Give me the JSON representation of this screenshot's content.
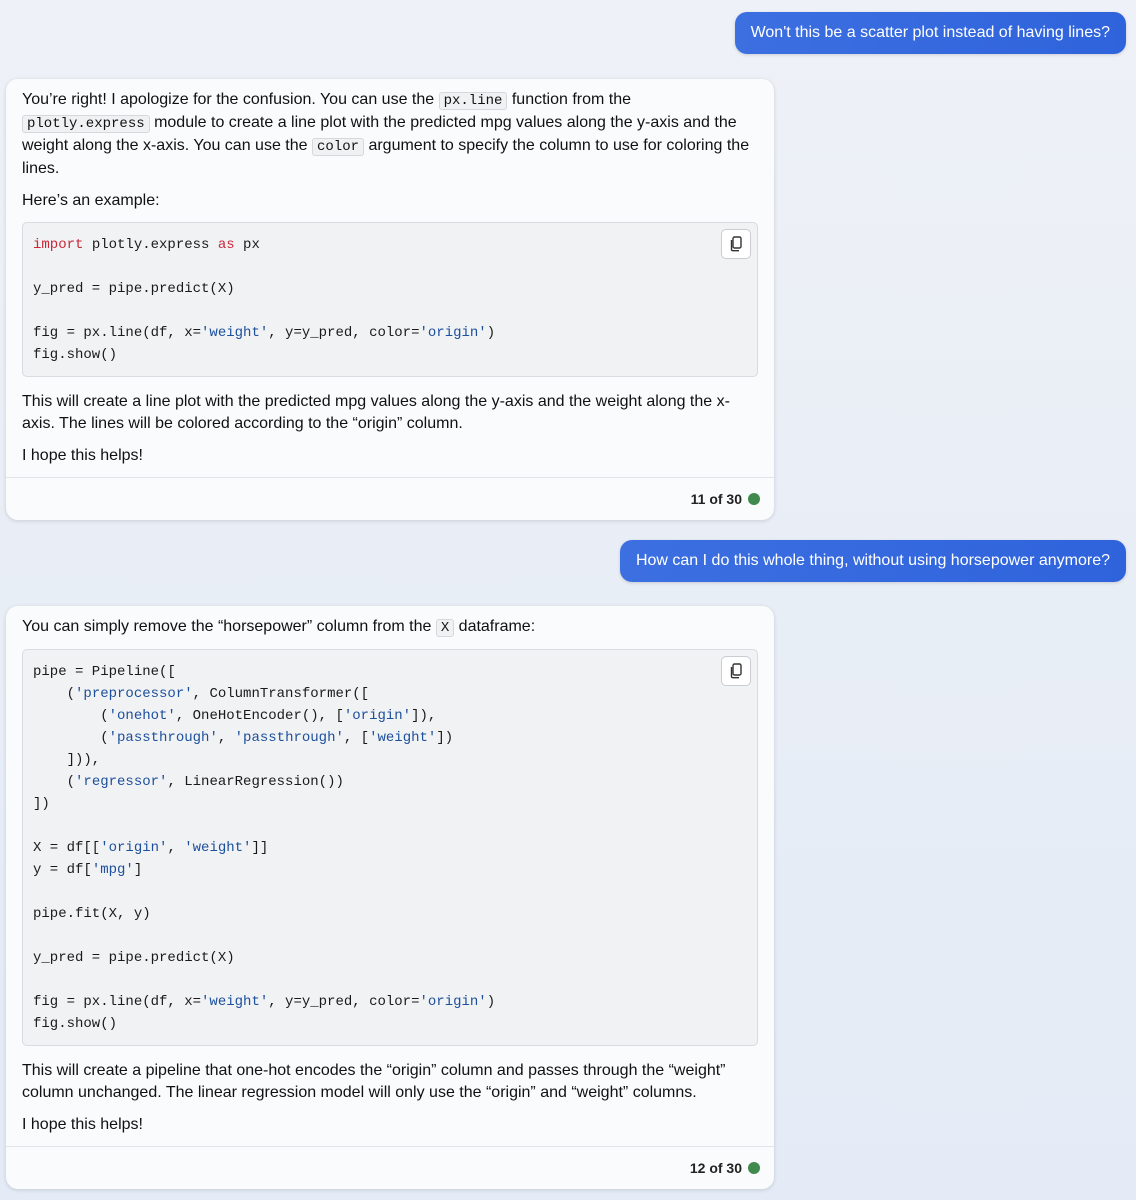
{
  "colors": {
    "user_bubble": "#2f63dc",
    "keyword": "#c8293a",
    "string": "#1c4f9c",
    "status_dot": "#3f8a4c"
  },
  "conversation": [
    {
      "role": "user",
      "text": "Won't this be a scatter plot instead of having lines?"
    },
    {
      "role": "assistant",
      "p1": {
        "a": "You’re right! I apologize for the confusion. You can use the ",
        "code1": "px.line",
        "b": " function from the ",
        "code2": "plotly.express",
        "c": " module to create a line plot with the predicted mpg values along the y-axis and the weight along the x-axis. You can use the ",
        "code3": "color",
        "d": " argument to specify the column to use for coloring the lines."
      },
      "p2": "Here’s an example:",
      "code": {
        "l1_kw1": "import",
        "l1_mid": " plotly.express ",
        "l1_kw2": "as",
        "l1_end": " px",
        "l3": "y_pred = pipe.predict(X)",
        "l5_a": "fig = px.line(df, x=",
        "l5_s1": "'weight'",
        "l5_b": ", y=y_pred, color=",
        "l5_s2": "'origin'",
        "l5_c": ")",
        "l6": "fig.show()"
      },
      "p3": "This will create a line plot with the predicted mpg values along the y-axis and the weight along the x-axis. The lines will be colored according to the “origin” column.",
      "p4": "I hope this helps!",
      "counter": "11 of 30"
    },
    {
      "role": "user",
      "text": "How can I do this whole thing, without using horsepower anymore?"
    },
    {
      "role": "assistant",
      "p1": {
        "a": "You can simply remove the “horsepower” column from the ",
        "code1": "X",
        "b": " dataframe:"
      },
      "code": {
        "l1": "pipe = Pipeline([",
        "l2_a": "    (",
        "l2_s": "'preprocessor'",
        "l2_b": ", ColumnTransformer([",
        "l3_a": "        (",
        "l3_s1": "'onehot'",
        "l3_b": ", OneHotEncoder(), [",
        "l3_s2": "'origin'",
        "l3_c": "]),",
        "l4_a": "        (",
        "l4_s1": "'passthrough'",
        "l4_b": ", ",
        "l4_s2": "'passthrough'",
        "l4_c": ", [",
        "l4_s3": "'weight'",
        "l4_d": "])",
        "l5": "    ])),",
        "l6_a": "    (",
        "l6_s": "'regressor'",
        "l6_b": ", LinearRegression())",
        "l7": "])",
        "l9_a": "X = df[[",
        "l9_s1": "'origin'",
        "l9_b": ", ",
        "l9_s2": "'weight'",
        "l9_c": "]]",
        "l10_a": "y = df[",
        "l10_s": "'mpg'",
        "l10_b": "]",
        "l12": "pipe.fit(X, y)",
        "l14": "y_pred = pipe.predict(X)",
        "l16_a": "fig = px.line(df, x=",
        "l16_s1": "'weight'",
        "l16_b": ", y=y_pred, color=",
        "l16_s2": "'origin'",
        "l16_c": ")",
        "l17": "fig.show()"
      },
      "p3": "This will create a pipeline that one-hot encodes the “origin” column and passes through the “weight” column unchanged. The linear regression model will only use the “origin” and “weight” columns.",
      "p4": "I hope this helps!",
      "counter": "12 of 30"
    }
  ],
  "icons": {
    "copy": "copy-icon",
    "status": "status-dot-icon"
  }
}
